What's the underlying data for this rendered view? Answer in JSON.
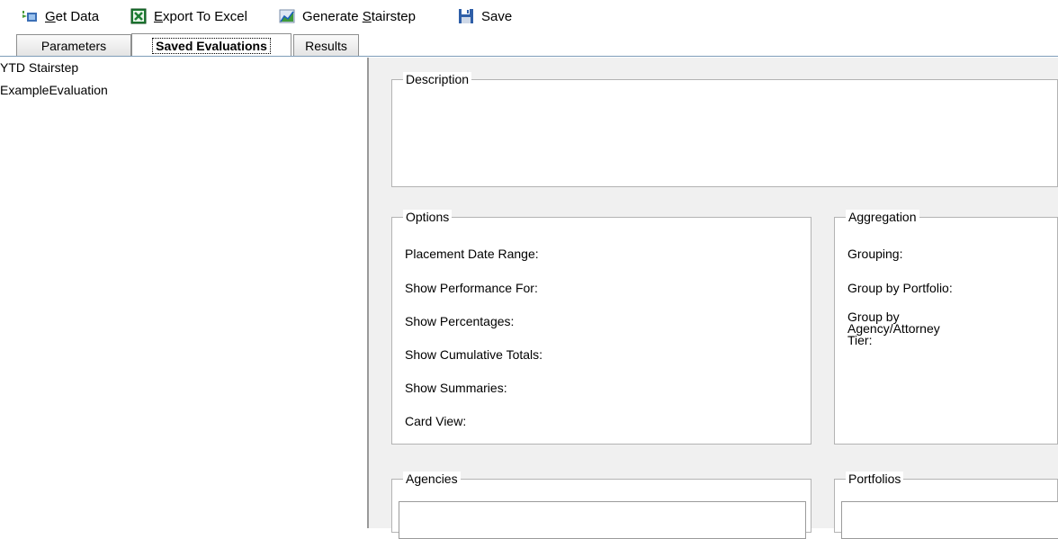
{
  "toolbar": {
    "get_data": {
      "underline": "G",
      "rest": "et Data",
      "icon": "get-data-icon"
    },
    "export": {
      "underline": "E",
      "rest": "xport To Excel",
      "icon": "excel-icon"
    },
    "generate": {
      "prefix": "Generate ",
      "underline": "S",
      "rest": "tairstep",
      "icon": "chart-icon"
    },
    "save": {
      "label": "Save",
      "icon": "floppy-disk-icon"
    }
  },
  "tabs": [
    {
      "label": "Parameters",
      "active": false
    },
    {
      "label": "Saved Evaluations",
      "active": true
    },
    {
      "label": "Results",
      "active": false
    }
  ],
  "saved_list": [
    "YTD Stairstep",
    "ExampleEvaluation"
  ],
  "description": {
    "legend": "Description"
  },
  "options": {
    "legend": "Options",
    "fields": [
      "Placement Date Range:",
      "Show Performance For:",
      "Show Percentages:",
      "Show Cumulative Totals:",
      "Show Summaries:",
      "Card View:"
    ]
  },
  "aggregation": {
    "legend": "Aggregation",
    "grouping": "Grouping:",
    "group_by_portfolio": "Group by Portfolio:",
    "group_by_agency": [
      "Group by",
      "Agency/Attorney",
      "Tier:"
    ]
  },
  "agencies": {
    "legend": "Agencies"
  },
  "portfolios": {
    "legend": "Portfolios"
  },
  "colors": {
    "accent": "#7f9db9",
    "panel_bg": "#f0f0f0",
    "border": "#b3b3b3"
  }
}
